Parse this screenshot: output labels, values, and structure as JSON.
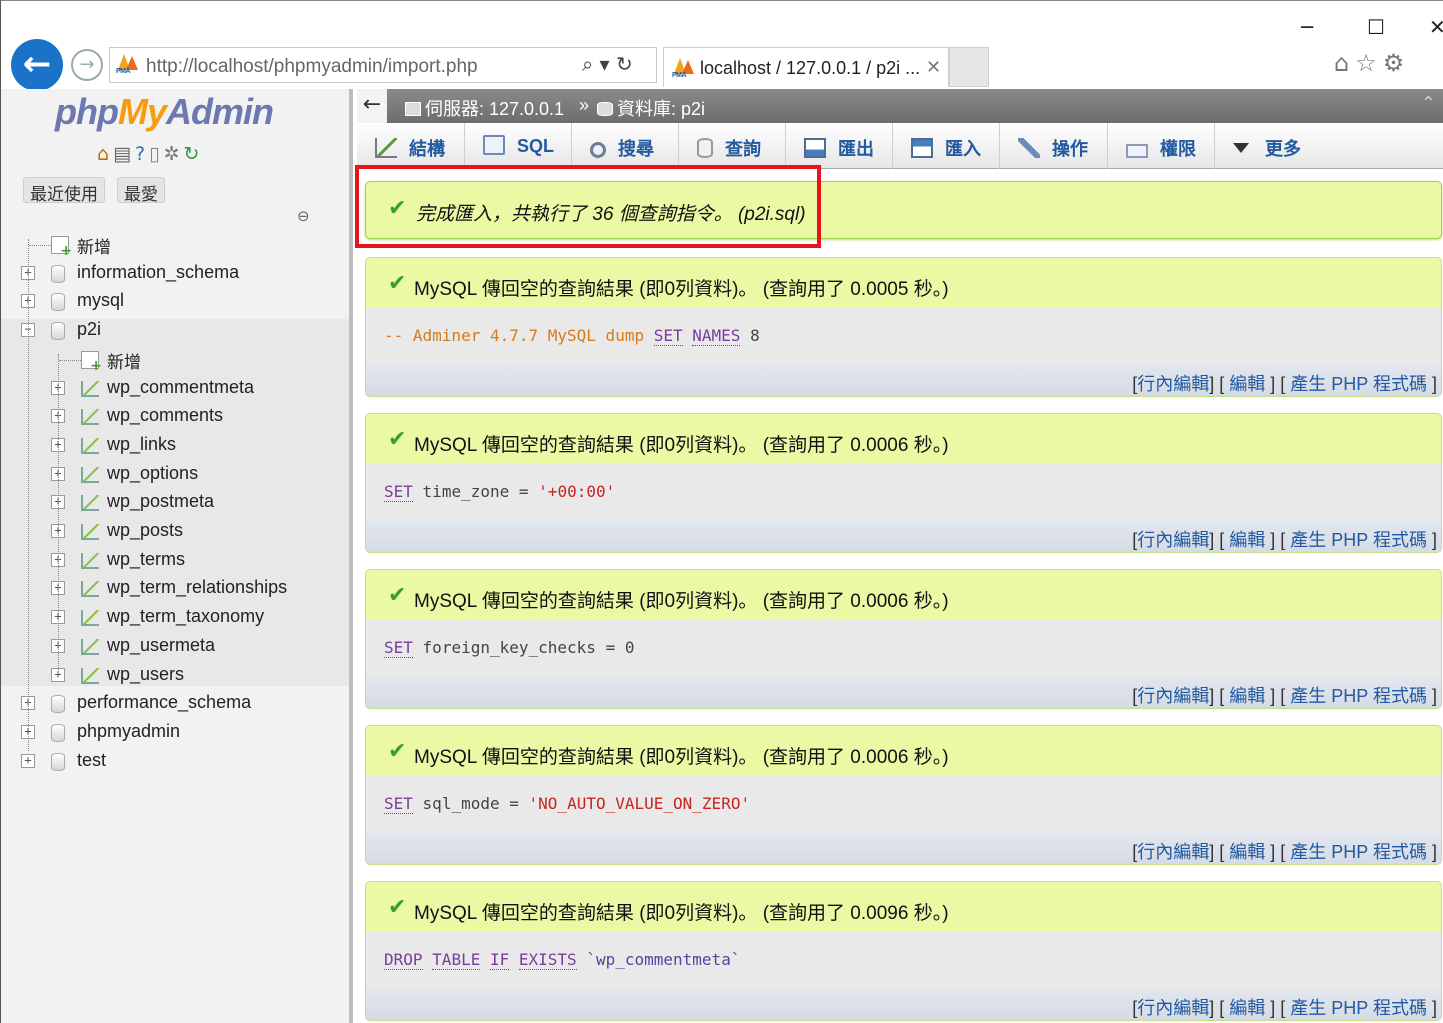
{
  "browser": {
    "window_controls": [
      "─",
      "☐",
      "✕"
    ],
    "url": "http://localhost/phpmyadmin/import.php",
    "address_tools": "⌕ ▾  ↻",
    "tab_title": "localhost / 127.0.0.1 / p2i ...",
    "tab_close": "✕",
    "toolbar_icons": [
      "home-icon",
      "star-icon",
      "gear-icon"
    ],
    "favicon_text": "PMA"
  },
  "nav": {
    "logo": {
      "php": "php",
      "my": "My",
      "admin": "Admin"
    },
    "tabs": [
      "最近使用",
      "最愛"
    ],
    "link_glyph": "⊖",
    "tree": [
      {
        "label": "新增",
        "type": "new",
        "level": 0
      },
      {
        "label": "information_schema",
        "type": "db",
        "level": 0
      },
      {
        "label": "mysql",
        "type": "db",
        "level": 0
      },
      {
        "label": "p2i",
        "type": "db",
        "level": 0,
        "expanded": true
      },
      {
        "label": "新增",
        "type": "new",
        "level": 1
      },
      {
        "label": "wp_commentmeta",
        "type": "table",
        "level": 1
      },
      {
        "label": "wp_comments",
        "type": "table",
        "level": 1
      },
      {
        "label": "wp_links",
        "type": "table",
        "level": 1
      },
      {
        "label": "wp_options",
        "type": "table",
        "level": 1
      },
      {
        "label": "wp_postmeta",
        "type": "table",
        "level": 1
      },
      {
        "label": "wp_posts",
        "type": "table",
        "level": 1
      },
      {
        "label": "wp_terms",
        "type": "table",
        "level": 1
      },
      {
        "label": "wp_term_relationships",
        "type": "table",
        "level": 1
      },
      {
        "label": "wp_term_taxonomy",
        "type": "table",
        "level": 1
      },
      {
        "label": "wp_usermeta",
        "type": "table",
        "level": 1
      },
      {
        "label": "wp_users",
        "type": "table",
        "level": 1
      },
      {
        "label": "performance_schema",
        "type": "db",
        "level": 0
      },
      {
        "label": "phpmyadmin",
        "type": "db",
        "level": 0
      },
      {
        "label": "test",
        "type": "db",
        "level": 0
      }
    ]
  },
  "breadcrumb": {
    "back": "←",
    "server": "伺服器: 127.0.0.1",
    "separator": "»",
    "database": "資料庫: p2i"
  },
  "menu": [
    {
      "label": "結構",
      "icon": "structure-icon"
    },
    {
      "label": "SQL",
      "icon": "sql-icon"
    },
    {
      "label": "搜尋",
      "icon": "search-icon"
    },
    {
      "label": "查詢",
      "icon": "query-icon"
    },
    {
      "label": "匯出",
      "icon": "export-icon"
    },
    {
      "label": "匯入",
      "icon": "import-icon"
    },
    {
      "label": "操作",
      "icon": "operations-icon"
    },
    {
      "label": "權限",
      "icon": "privileges-icon"
    },
    {
      "label": "更多",
      "icon": "more-icon"
    }
  ],
  "import_message": "完成匯入，共執行了 36 個查詢指令。 (p2i.sql)",
  "results": [
    {
      "message": "MySQL 傳回空的查詢結果 (即0列資料)。 (查詢用了 0.0005 秒。)",
      "sql": "-- Adminer 4.7.7 MySQL dump SET NAMES utf8"
    },
    {
      "message": "MySQL 傳回空的查詢結果 (即0列資料)。 (查詢用了 0.0006 秒。)",
      "sql": "SET time_zone = '+00:00'"
    },
    {
      "message": "MySQL 傳回空的查詢結果 (即0列資料)。 (查詢用了 0.0006 秒。)",
      "sql": "SET foreign_key_checks = 0"
    },
    {
      "message": "MySQL 傳回空的查詢結果 (即0列資料)。 (查詢用了 0.0006 秒。)",
      "sql": "SET sql_mode = 'NO_AUTO_VALUE_ON_ZERO'"
    },
    {
      "message": "MySQL 傳回空的查詢結果 (即0列資料)。 (查詢用了 0.0096 秒。)",
      "sql": "DROP TABLE IF EXISTS `wp_commentmeta`"
    }
  ],
  "result_links": {
    "inline_edit": "行內編輯",
    "edit": "編輯",
    "create_php": "產生 PHP 程式碼"
  },
  "colors": {
    "success_bg": "#ebf8a4",
    "success_border": "#a2d246",
    "highlight": "#e8141b",
    "link": "#235a9f"
  }
}
